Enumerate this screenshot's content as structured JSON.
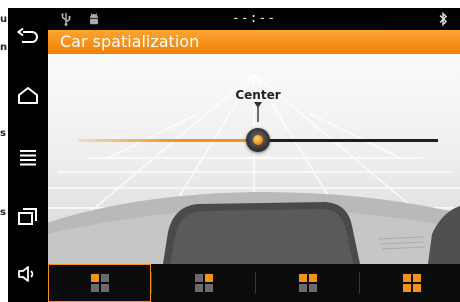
{
  "page_edge": {
    "clipped_fragments": [
      "u",
      "n",
      "s",
      "s"
    ]
  },
  "status_bar": {
    "time": "--:--",
    "left_icons": [
      "usb-icon",
      "android-debug-icon"
    ],
    "right_icons": [
      "bluetooth-icon"
    ]
  },
  "navigation_bar": {
    "buttons": [
      "back-icon",
      "home-icon",
      "menu-icon",
      "recent-apps-icon",
      "volume-icon"
    ]
  },
  "app": {
    "title": "Car spatialization",
    "accent_color": "#f29418"
  },
  "spatialization": {
    "position_label": "Center",
    "slider_value": 0.5
  },
  "tabs": [
    {
      "icon": "seat-front-left-icon",
      "active": true
    },
    {
      "icon": "seat-front-right-icon",
      "active": false
    },
    {
      "icon": "seat-front-row-icon",
      "active": false
    },
    {
      "icon": "seat-all-icon",
      "active": false
    }
  ]
}
